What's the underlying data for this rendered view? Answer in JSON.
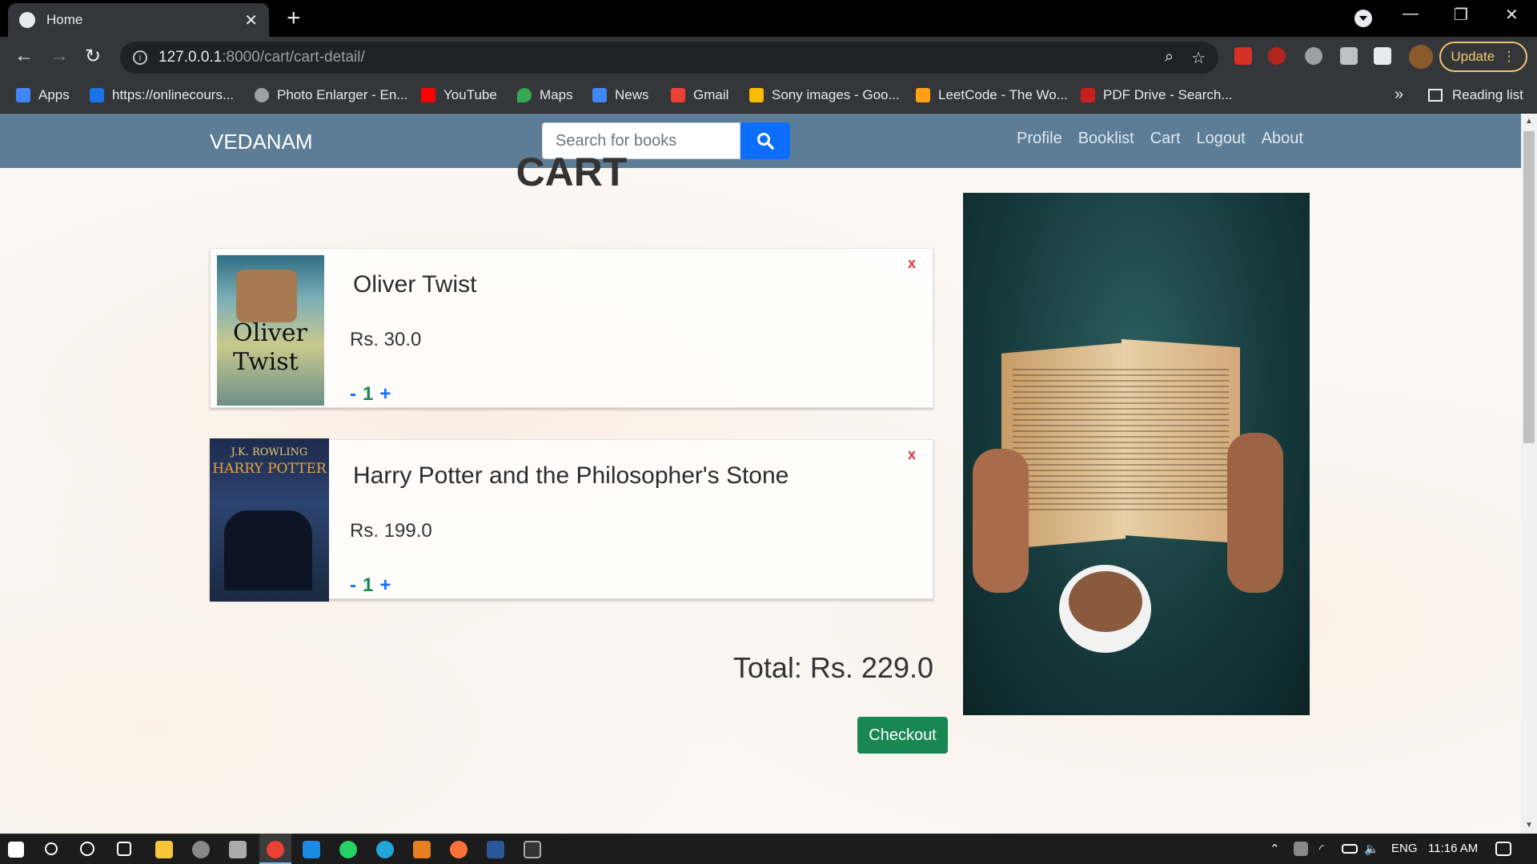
{
  "browser": {
    "tab_title": "Home",
    "tab_close": "✕",
    "new_tab": "+",
    "url_host": "127.0.0.1",
    "url_path": ":8000/cart/cart-detail/",
    "update_label": "Update",
    "bookmarks": [
      {
        "label": "Apps",
        "color": "#4285f4"
      },
      {
        "label": "https://onlinecours...",
        "color": "#1a73e8"
      },
      {
        "label": "Photo Enlarger - En...",
        "color": "#9aa0a6"
      },
      {
        "label": "YouTube",
        "color": "#ff0000"
      },
      {
        "label": "Maps",
        "color": "#34a853"
      },
      {
        "label": "News",
        "color": "#4285f4"
      },
      {
        "label": "Gmail",
        "color": "#ea4335"
      },
      {
        "label": "Sony images - Goo...",
        "color": "#fbbc04"
      },
      {
        "label": "LeetCode - The Wo...",
        "color": "#ffa116"
      },
      {
        "label": "PDF Drive - Search...",
        "color": "#c5221f"
      }
    ],
    "more_bookmarks": "»",
    "reading_list": "Reading list"
  },
  "site": {
    "brand": "VEDANAM",
    "search_placeholder": "Search for books",
    "nav": [
      "Profile",
      "Booklist",
      "Cart",
      "Logout",
      "About"
    ]
  },
  "cart": {
    "title": "CART",
    "items": [
      {
        "name": "Oliver Twist",
        "price": "Rs. 30.0",
        "qty": "1",
        "cover_title": "Oliver Twist"
      },
      {
        "name": "Harry Potter and the Philosopher's Stone",
        "price": "Rs. 199.0",
        "qty": "1",
        "cover_author": "J.K. ROWLING",
        "cover_title": "HARRY POTTER"
      }
    ],
    "remove_label": "x",
    "minus_label": "-",
    "plus_label": "+",
    "total": "Total: Rs. 229.0",
    "checkout": "Checkout"
  },
  "taskbar": {
    "lang": "ENG",
    "time": "11:16 AM"
  },
  "colors": {
    "navbar": "#5c7d95",
    "search_button": "#0d6efd",
    "checkout": "#198754",
    "remove": "#dc3545"
  }
}
